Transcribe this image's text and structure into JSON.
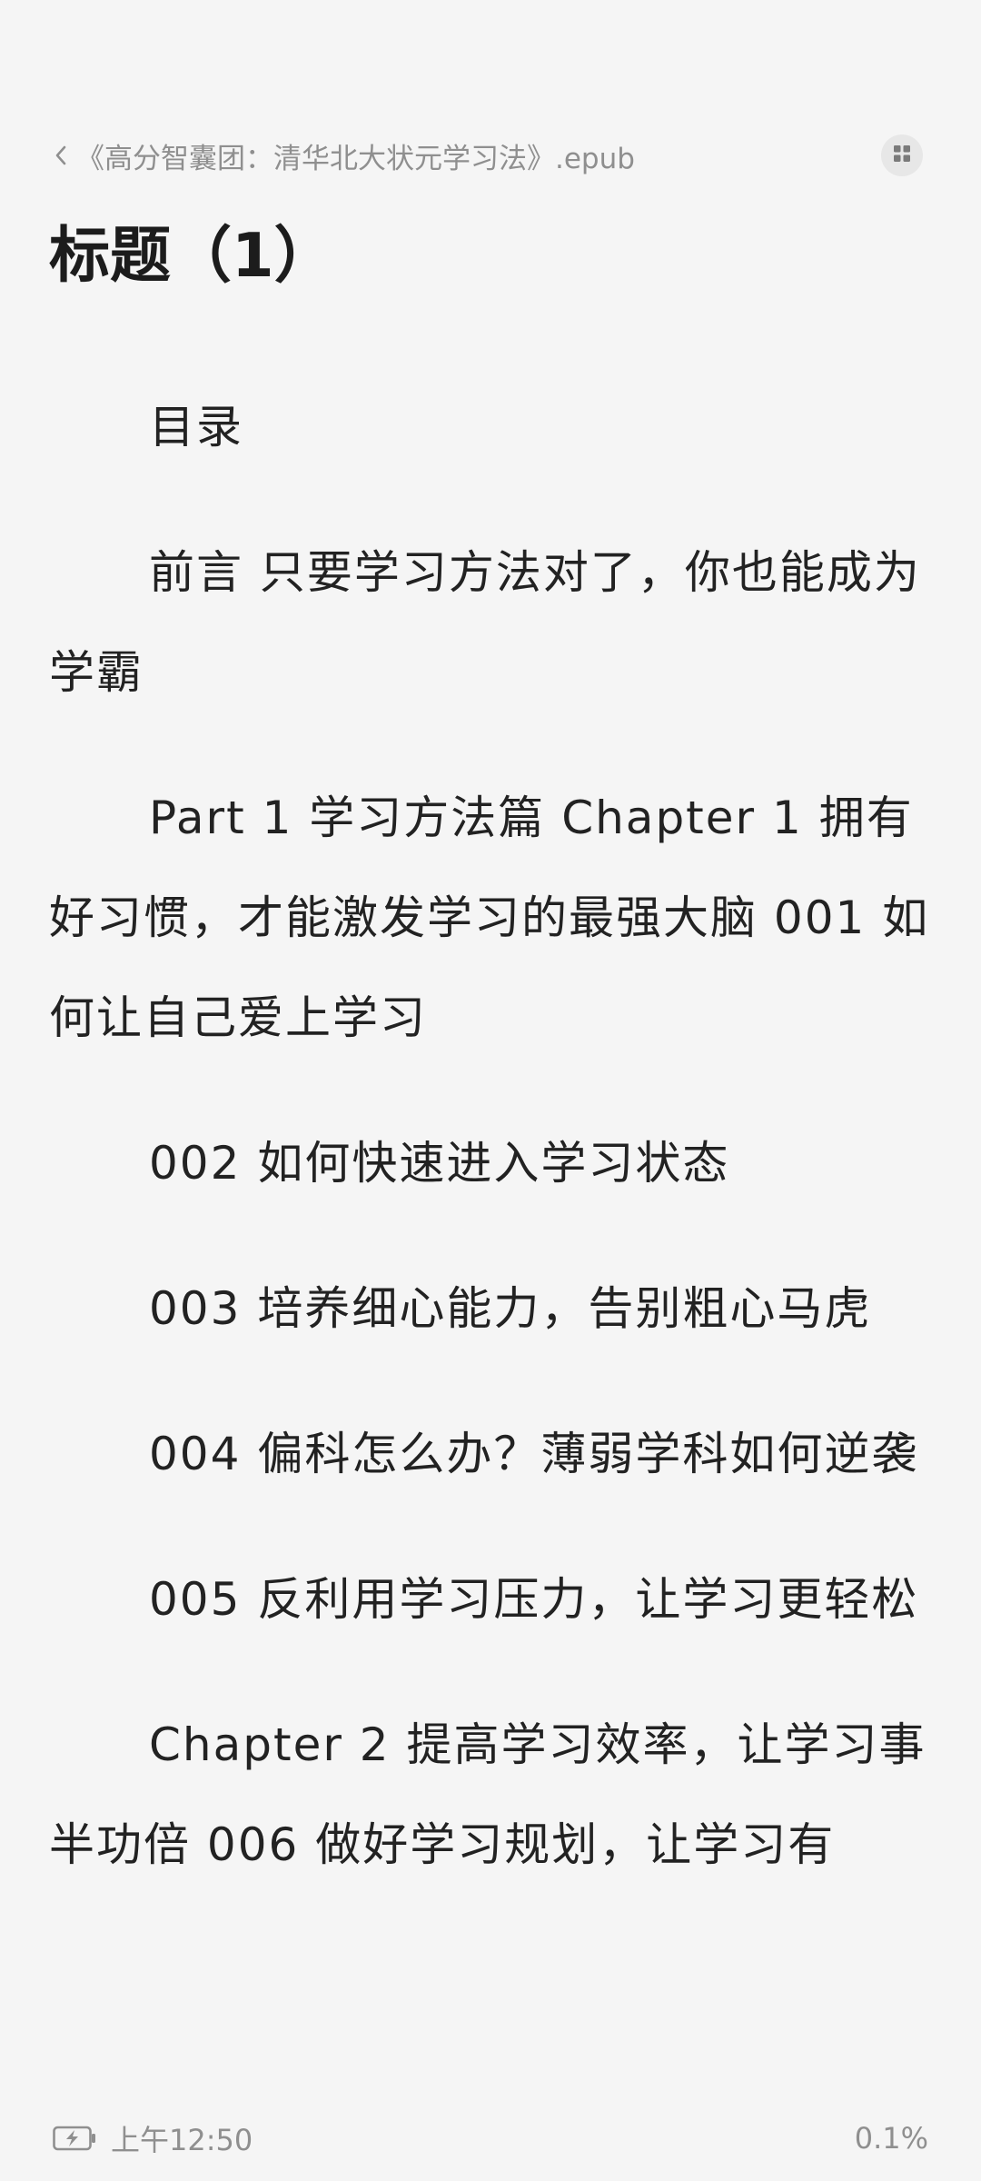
{
  "header": {
    "book_title": "《高分智囊团：清华北大状元学习法》.epub"
  },
  "chapter": {
    "title": "标题（1）"
  },
  "paragraphs": [
    "目录",
    "前言 只要学习方法对了，你也能成为学霸",
    "Part 1 学习方法篇 Chapter 1 拥有好习惯，才能激发学习的最强大脑 001 如何让自己爱上学习",
    "002 如何快速进入学习状态",
    "003 培养细心能力，告别粗心马虎",
    "004 偏科怎么办？薄弱学科如何逆袭",
    "005 反利用学习压力，让学习更轻松",
    "Chapter 2 提高学习效率，让学习事半功倍 006 做好学习规划，让学习有"
  ],
  "footer": {
    "time": "上午12:50",
    "progress": "0.1%"
  },
  "icons": {
    "back": "chevron-left-icon",
    "menu": "grid-icon",
    "battery": "battery-charging-icon"
  },
  "colors": {
    "background": "#f5f5f5",
    "text": "#222222",
    "muted": "#8f8f8f"
  }
}
